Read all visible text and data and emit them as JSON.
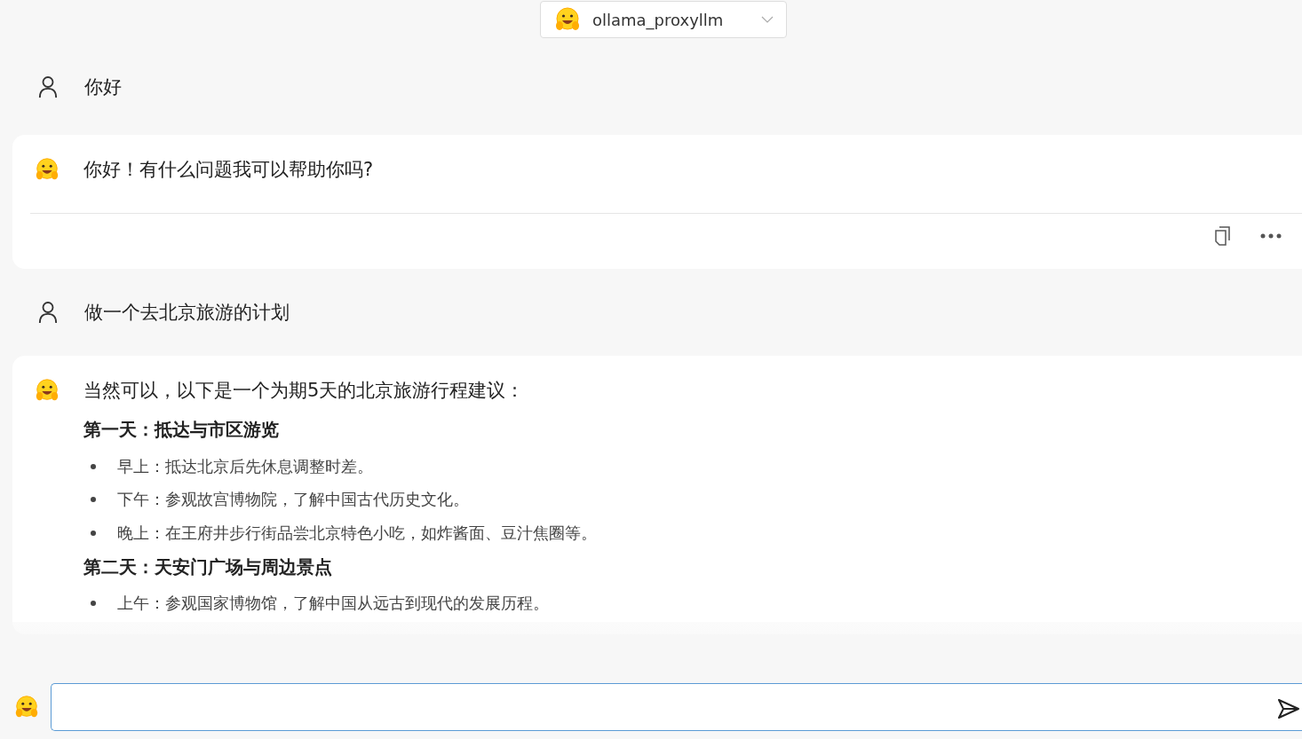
{
  "model_selector": {
    "value": "ollama_proxyllm"
  },
  "messages": [
    {
      "kind": "user",
      "text": "你好"
    },
    {
      "kind": "assistant",
      "actions": true,
      "blocks": [
        {
          "kind": "paragraph",
          "text": "你好！有什么问题我可以帮助你吗?"
        }
      ]
    },
    {
      "kind": "user",
      "text": "做一个去北京旅游的计划"
    },
    {
      "kind": "assistant",
      "actions": false,
      "blocks": [
        {
          "kind": "paragraph",
          "text": "当然可以，以下是一个为期5天的北京旅游行程建议："
        },
        {
          "kind": "heading",
          "text": "第一天：抵达与市区游览"
        },
        {
          "kind": "bullet",
          "text": "早上：抵达北京后先休息调整时差。"
        },
        {
          "kind": "bullet",
          "text": "下午：参观故宫博物院，了解中国古代历史文化。"
        },
        {
          "kind": "bullet",
          "text": "晚上：在王府井步行街品尝北京特色小吃，如炸酱面、豆汁焦圈等。"
        },
        {
          "kind": "heading",
          "text": "第二天：天安门广场与周边景点"
        },
        {
          "kind": "bullet",
          "text": "上午：参观国家博物馆，了解中国从远古到现代的发展历程。"
        }
      ]
    }
  ]
}
